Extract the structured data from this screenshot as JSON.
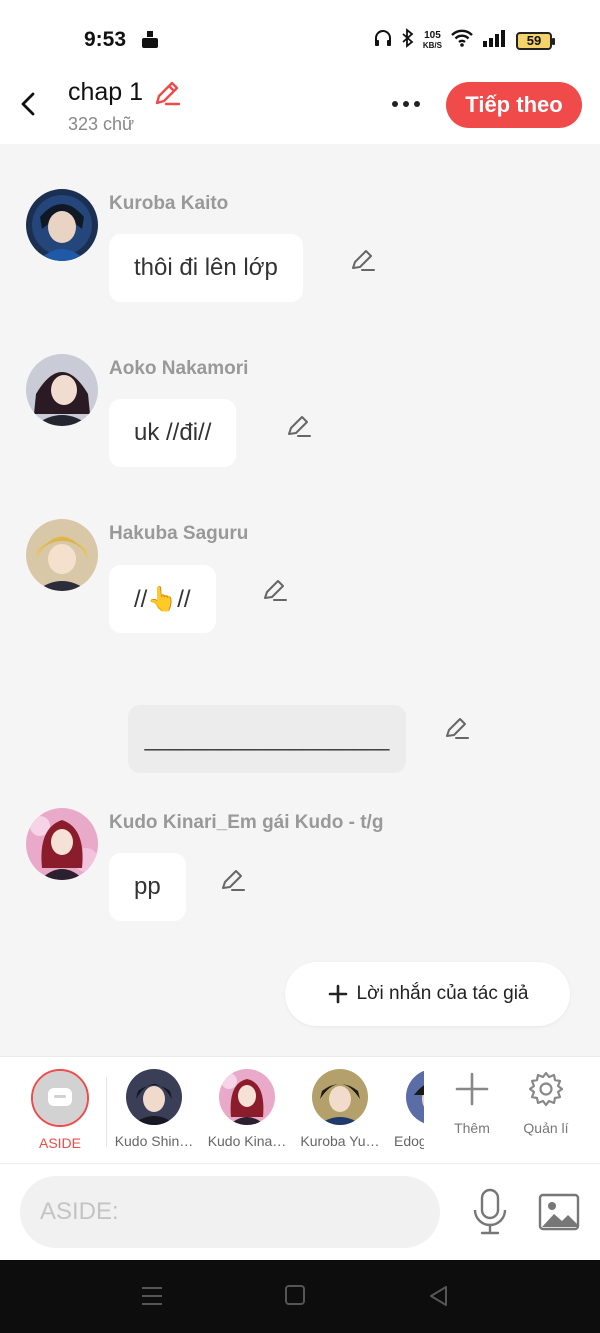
{
  "status_bar": {
    "time": "9:53",
    "net_speed_value": "105",
    "net_speed_unit": "KB/S",
    "battery": "59"
  },
  "header": {
    "title": "chap 1",
    "subtitle": "323 chữ",
    "next_label": "Tiếp theo"
  },
  "messages": [
    {
      "sender": "Kuroba Kaito",
      "text": "thôi đi lên lớp"
    },
    {
      "sender": "Aoko Nakamori",
      "text": "uk //đi//"
    },
    {
      "sender": "Hakuba Saguru",
      "text": "//👆//"
    },
    {
      "sender": "Kudo Kinari_Em gái Kudo - t/g",
      "text": "pp"
    }
  ],
  "divider": {
    "text": "____________________"
  },
  "author_note": {
    "label": "Lời nhắn của tác giả"
  },
  "character_bar": {
    "aside_label": "ASIDE",
    "characters": [
      {
        "label": "Kudo Shin…"
      },
      {
        "label": "Kudo Kina…"
      },
      {
        "label": "Kuroba Yu…"
      },
      {
        "label": "Edog"
      }
    ],
    "add_label": "Thêm",
    "manage_label": "Quản lí"
  },
  "input": {
    "placeholder": "ASIDE:"
  },
  "colors": {
    "accent": "#f04a4a",
    "background": "#f5f5f5"
  }
}
